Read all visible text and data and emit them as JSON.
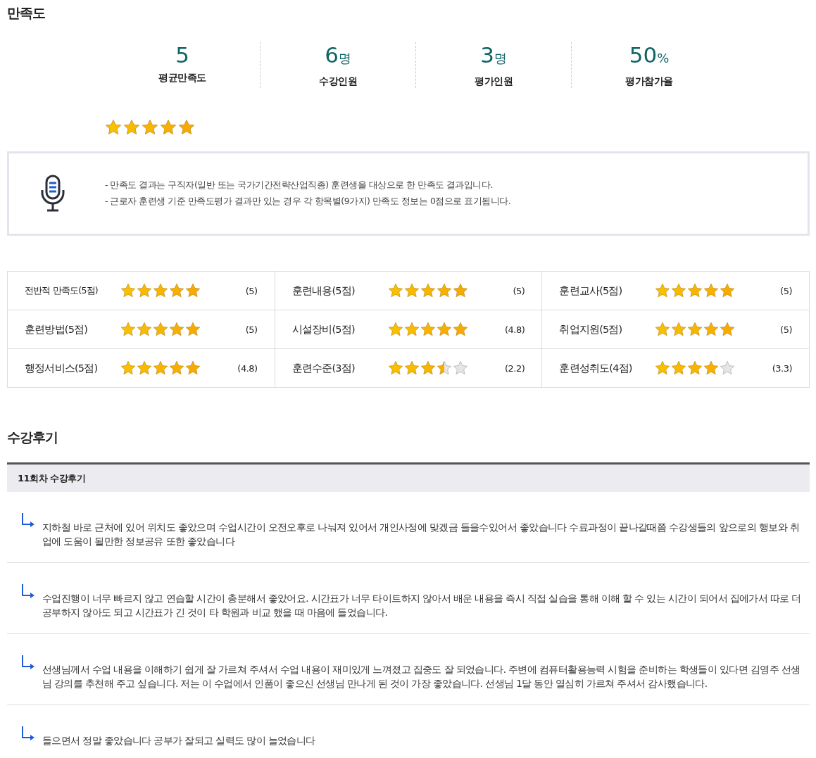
{
  "satisfaction": {
    "title": "만족도",
    "stats": [
      {
        "value": "5",
        "label": "평균만족도"
      },
      {
        "value": "6",
        "unit": "명",
        "label": "수강인원"
      },
      {
        "value": "3",
        "unit": "명",
        "label": "평가인원"
      },
      {
        "value": "50",
        "unit": "%",
        "label": "평가참가율"
      }
    ],
    "stars": 5,
    "notices": [
      "- 만족도 결과는 구직자(일반 또는 국가기간전략산업직종) 훈련생을 대상으로 한 만족도 결과입니다.",
      "- 근로자 훈련생 기준 만족도평가 결과만 있는 경우 각 항목별(9가지) 만족도 정보는 0점으로 표기됩니다."
    ],
    "ratings": [
      {
        "label": "전반적 만족도(5점)",
        "stars": 5,
        "score": "(5)"
      },
      {
        "label": "훈련내용(5점)",
        "stars": 5,
        "score": "(5)"
      },
      {
        "label": "훈련교사(5점)",
        "stars": 5,
        "score": "(5)"
      },
      {
        "label": "훈련방법(5점)",
        "stars": 5,
        "score": "(5)"
      },
      {
        "label": "시설장비(5점)",
        "stars": 5,
        "score": "(4.8)"
      },
      {
        "label": "취업지원(5점)",
        "stars": 5,
        "score": "(5)"
      },
      {
        "label": "행정서비스(5점)",
        "stars": 5,
        "score": "(4.8)"
      },
      {
        "label": "훈련수준(3점)",
        "stars": 3.5,
        "score": "(2.2)"
      },
      {
        "label": "훈련성취도(4점)",
        "stars": 4,
        "score": "(3.3)"
      }
    ]
  },
  "reviews": {
    "title": "수강후기",
    "group": "11회차 수강후기",
    "items": [
      "지하철 바로 근처에 있어 위치도 좋았으며 수업시간이 오전오후로 나눠져 있어서 개인사정에 맞겠금 들을수있어서 좋았습니다 수료과정이 끝나갈때쯤 수강생들의 앞으로의 행보와 취업에 도움이 될만한 정보공유 또한 좋았습니다",
      "수업진행이 너무 빠르지 않고 연습할 시간이 충분해서 좋았어요. 시간표가 너무 타이트하지 않아서 배운 내용을 즉시 직접 실습을 통해 이해 할 수 있는 시간이 되어서 집에가서 따로 더 공부하지 않아도 되고 시간표가 긴 것이 타 학원과 비교 했을 때 마음에 들었습니다.",
      "선생님께서 수업 내용을 이해하기 쉽게 잘 가르쳐 주셔서 수업 내용이 재미있게 느껴졌고 집중도 잘 되었습니다. 주변에 컴퓨터활용능력 시험을 준비하는 학생들이 있다면 김영주 선생님 강의를 추천해 주고 싶습니다. 저는 이 수업에서 인품이 좋으신 선생님 만나게 된 것이 가장 좋았습니다. 선생님 1달 동안 열심히 가르쳐 주셔서 감사했습니다.",
      "들으면서 정말 좋았습니다 공부가 잘되고 실력도 많이 늘었습니다"
    ]
  }
}
